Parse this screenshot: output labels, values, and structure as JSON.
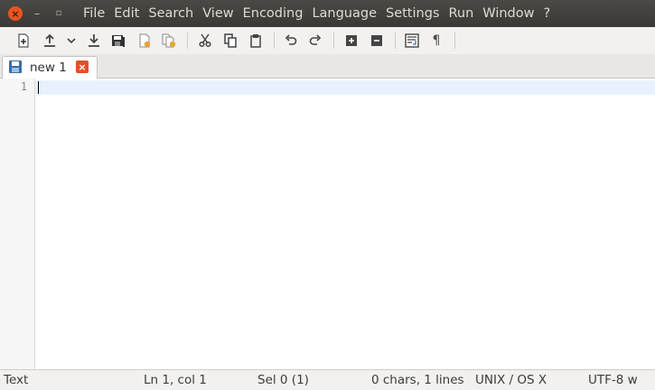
{
  "menu": {
    "items": [
      "File",
      "Edit",
      "Search",
      "View",
      "Encoding",
      "Language",
      "Settings",
      "Run",
      "Window",
      "?"
    ]
  },
  "toolbar": {
    "icons": [
      "new-file-icon",
      "open-file-icon",
      "dropdown-arrow-icon",
      "save-icon",
      "save-all-icon",
      "close-file-icon",
      "close-all-icon",
      "cut-icon",
      "copy-icon",
      "paste-icon",
      "undo-icon",
      "redo-icon",
      "zoom-in-icon",
      "zoom-out-icon",
      "wrap-icon",
      "show-all-chars-icon"
    ]
  },
  "tabs": [
    {
      "label": "new 1",
      "active": true
    }
  ],
  "editor": {
    "line_numbers": [
      "1"
    ],
    "content": ""
  },
  "status": {
    "language": "Text",
    "position": "Ln 1, col 1",
    "selection": "Sel 0 (1)",
    "counts": "0 chars, 1 lines",
    "eol": "UNIX / OS X",
    "encoding": "UTF-8 w"
  },
  "colors": {
    "titlebar": "#3c3b37",
    "close_button": "#e95420",
    "tab_close": "#e0502a",
    "current_line": "#e8f2fe"
  }
}
